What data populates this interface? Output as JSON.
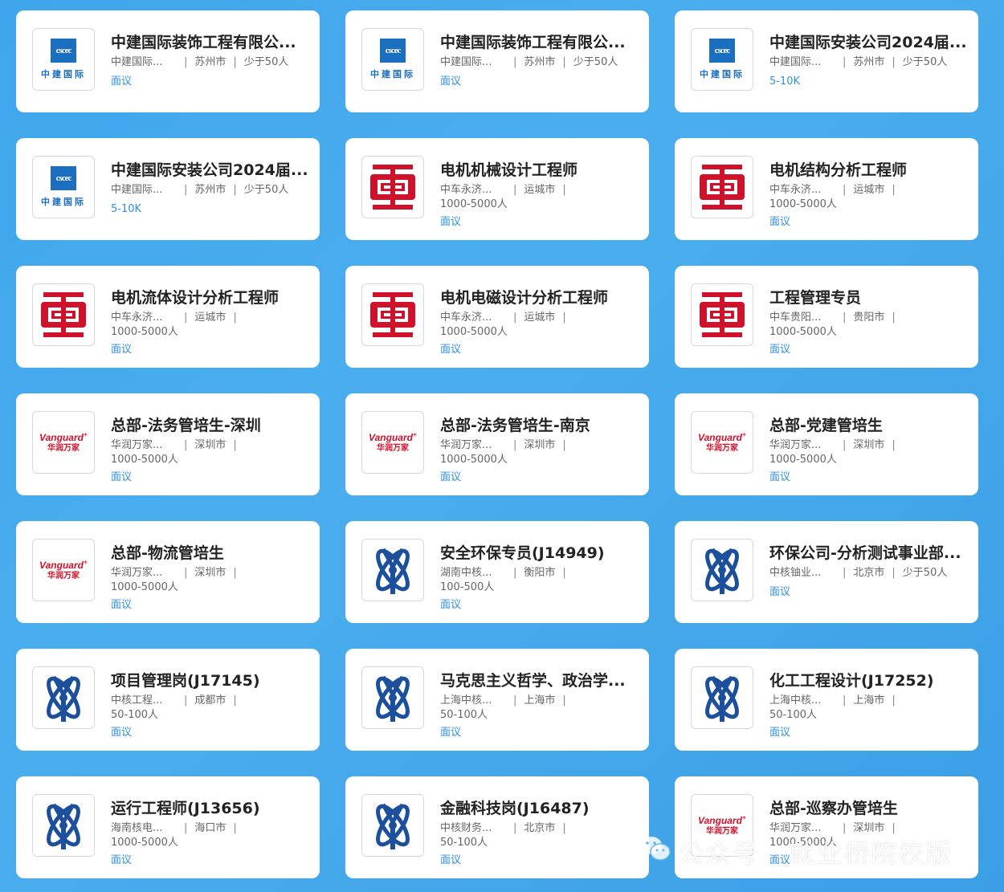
{
  "cards": [
    {
      "logo": "cscec",
      "logo_mark": "cscec",
      "logo_text": "中建国际",
      "title": "中建国际装饰工程有限公...",
      "company": "中建国际...",
      "city": "苏州市",
      "size": "少于50人",
      "salary": "面议"
    },
    {
      "logo": "cscec",
      "logo_mark": "cscec",
      "logo_text": "中建国际",
      "title": "中建国际装饰工程有限公...",
      "company": "中建国际...",
      "city": "苏州市",
      "size": "少于50人",
      "salary": "面议"
    },
    {
      "logo": "cscec",
      "logo_mark": "cscec",
      "logo_text": "中建国际",
      "title": "中建国际安装公司2024届...",
      "company": "中建国际...",
      "city": "苏州市",
      "size": "少于50人",
      "salary": "5-10K"
    },
    {
      "logo": "cscec",
      "logo_mark": "cscec",
      "logo_text": "中建国际",
      "title": "中建国际安装公司2024届...",
      "company": "中建国际...",
      "city": "苏州市",
      "size": "少于50人",
      "salary": "5-10K"
    },
    {
      "logo": "crrc",
      "title": "电机机械设计工程师",
      "company": "中车永济...",
      "city": "运城市",
      "size": "1000-5000人",
      "salary": "面议"
    },
    {
      "logo": "crrc",
      "title": "电机结构分析工程师",
      "company": "中车永济...",
      "city": "运城市",
      "size": "1000-5000人",
      "salary": "面议"
    },
    {
      "logo": "crrc",
      "title": "电机流体设计分析工程师",
      "company": "中车永济...",
      "city": "运城市",
      "size": "1000-5000人",
      "salary": "面议"
    },
    {
      "logo": "crrc",
      "title": "电机电磁设计分析工程师",
      "company": "中车永济...",
      "city": "运城市",
      "size": "1000-5000人",
      "salary": "面议"
    },
    {
      "logo": "crrc",
      "title": "工程管理专员",
      "company": "中车贵阳...",
      "city": "贵阳市",
      "size": "1000-5000人",
      "salary": "面议"
    },
    {
      "logo": "vanguard",
      "logo_en": "Vanguard",
      "logo_cn": "华润万家",
      "title": "总部-法务管培生-深圳",
      "company": "华润万家...",
      "city": "深圳市",
      "size": "1000-5000人",
      "salary": "面议"
    },
    {
      "logo": "vanguard",
      "logo_en": "Vanguard",
      "logo_cn": "华润万家",
      "title": "总部-法务管培生-南京",
      "company": "华润万家...",
      "city": "深圳市",
      "size": "1000-5000人",
      "salary": "面议"
    },
    {
      "logo": "vanguard",
      "logo_en": "Vanguard",
      "logo_cn": "华润万家",
      "title": "总部-党建管培生",
      "company": "华润万家...",
      "city": "深圳市",
      "size": "1000-5000人",
      "salary": "面议"
    },
    {
      "logo": "vanguard",
      "logo_en": "Vanguard",
      "logo_cn": "华润万家",
      "title": "总部-物流管培生",
      "company": "华润万家...",
      "city": "深圳市",
      "size": "1000-5000人",
      "salary": "面议"
    },
    {
      "logo": "cnnc",
      "title": "安全环保专员(J14949)",
      "company": "湖南中核...",
      "city": "衡阳市",
      "size": "100-500人",
      "salary": "面议"
    },
    {
      "logo": "cnnc",
      "title": "环保公司-分析测试事业部...",
      "company": "中核铀业...",
      "city": "北京市",
      "size": "少于50人",
      "salary": "面议"
    },
    {
      "logo": "cnnc",
      "title": "项目管理岗(J17145)",
      "company": "中核工程...",
      "city": "成都市",
      "size": "50-100人",
      "salary": "面议"
    },
    {
      "logo": "cnnc",
      "title": "马克思主义哲学、政治学...",
      "company": "上海中核...",
      "city": "上海市",
      "size": "50-100人",
      "salary": "面议"
    },
    {
      "logo": "cnnc",
      "title": "化工工程设计(J17252)",
      "company": "上海中核...",
      "city": "上海市",
      "size": "50-100人",
      "salary": "面议"
    },
    {
      "logo": "cnnc",
      "title": "运行工程师(J13656)",
      "company": "海南核电...",
      "city": "海口市",
      "size": "1000-5000人",
      "salary": "面议"
    },
    {
      "logo": "cnnc",
      "title": "金融科技岗(J16487)",
      "company": "中核财务...",
      "city": "北京市",
      "size": "50-100人",
      "salary": "面议"
    },
    {
      "logo": "vanguard",
      "logo_en": "Vanguard",
      "logo_cn": "华润万家",
      "title": "总部-巡察办管培生",
      "company": "华润万家...",
      "city": "深圳市",
      "size": "1000-5000人",
      "salary": "面议"
    }
  ],
  "separator": "|",
  "watermark": "公众号 · 就业桥院校版",
  "colors": {
    "accent": "#2f8fe6",
    "crrc_red": "#d0112b",
    "cnnc_blue": "#1c4f9c",
    "cscec_blue": "#1a6fc0",
    "bg": "#42a8ec"
  }
}
